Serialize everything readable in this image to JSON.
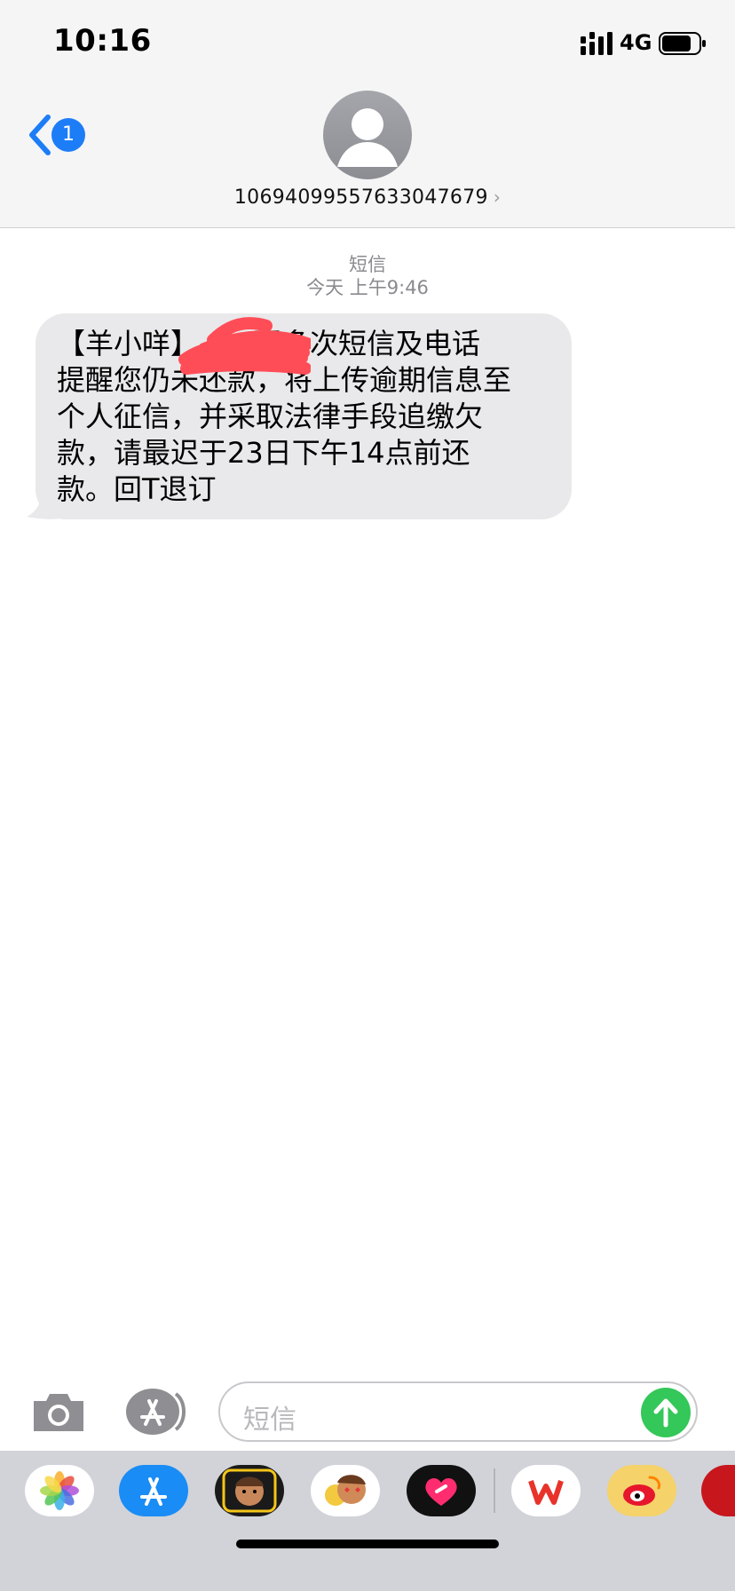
{
  "status_bar": {
    "time": "10:16",
    "network": "4G"
  },
  "nav": {
    "back_badge": "1",
    "contact_number": "10694099557633047679",
    "chevron": "›"
  },
  "message_meta": {
    "service": "短信",
    "timestamp": "今天 上午9:46"
  },
  "message": {
    "text": "【羊小咩】      因多次短信及电话\n提醒您仍未还款，将上传逾期信息至\n个人征信，并采取法律手段追缴欠\n款，请最迟于23日下午14点前还\n款。回T退订"
  },
  "compose": {
    "placeholder": "短信"
  },
  "colors": {
    "accent": "#1d7df7",
    "send": "#34c759",
    "bubble": "#e9e9eb",
    "redaction": "#ff4d57"
  },
  "icons": [
    "camera-icon",
    "app-store-icon",
    "send-arrow-icon",
    "back-chevron-icon",
    "person-icon",
    "photos-icon",
    "memoji-icon",
    "heart-icon",
    "wps-icon",
    "weibo-icon"
  ]
}
